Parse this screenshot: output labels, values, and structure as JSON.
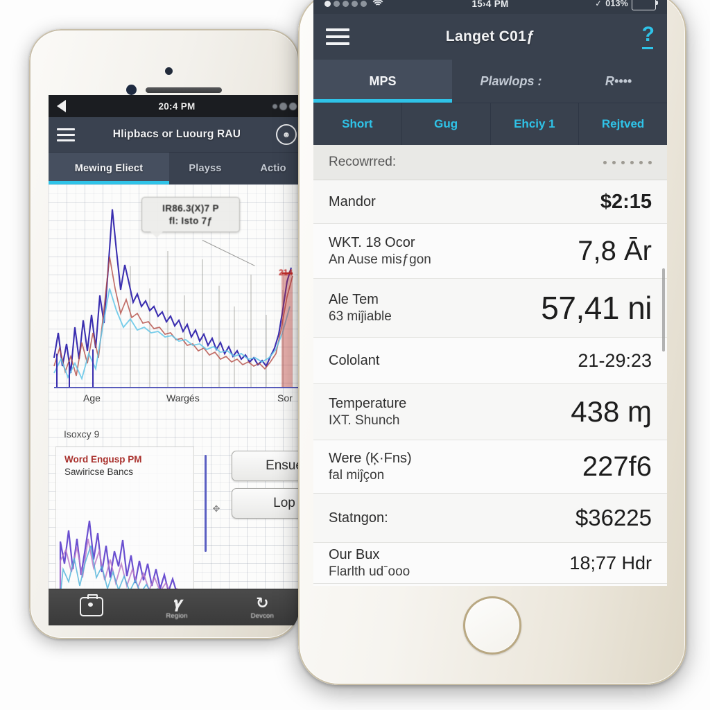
{
  "left_phone": {
    "status_bar": {
      "time": "20:4 PM",
      "back_icon": "back-arrow-icon"
    },
    "navbar": {
      "menu_icon": "hamburger-menu-icon",
      "title": "Hlipbacs or Luourg RAU",
      "avatar_icon": "user-avatar-icon"
    },
    "tabs": [
      {
        "label": "Mewing Eliect",
        "active": true
      },
      {
        "label": "Playss",
        "active": false
      },
      {
        "label": "Actio",
        "active": false
      }
    ],
    "chart": {
      "tooltip": {
        "line1": "IR86.3(X)7 P",
        "line2": "fl: Isto 7ƒ"
      },
      "red_annotation": "214",
      "x_labels": [
        "Age",
        "Wargés",
        "Sor"
      ],
      "section_label": "Isoxcy 9"
    },
    "mini_chart": {
      "legend": [
        {
          "label": "Word Engusp PM",
          "color": "#a9302c"
        },
        {
          "label": "Sawiricse Bancs",
          "color": "#333333"
        }
      ]
    },
    "buttons": [
      {
        "label": "Ensue"
      },
      {
        "label": "Lop"
      }
    ],
    "tab_bar": [
      {
        "icon": "camera-icon",
        "label": ""
      },
      {
        "icon": "pen-icon",
        "label": "Region"
      },
      {
        "icon": "refresh-icon",
        "label": "Devcon"
      }
    ]
  },
  "right_phone": {
    "status_bar": {
      "carrier": "● ● ● ● ●",
      "wifi_icon": "wifi-icon",
      "time": "15›4 PM",
      "check_icon": "check-icon",
      "battery_pct": "013%",
      "battery_icon": "battery-icon"
    },
    "navbar": {
      "menu_icon": "hamburger-menu-icon",
      "title": "Langet C01ƒ",
      "help_label": "?"
    },
    "tabs": [
      {
        "label": "MPS",
        "active": true
      },
      {
        "label": "Plawlops :",
        "active": false
      },
      {
        "label": "R••••",
        "active": false
      }
    ],
    "sub_tabs": [
      {
        "label": "Short"
      },
      {
        "label": "Gug"
      },
      {
        "label": "Ehciy 1"
      },
      {
        "label": "Rejtved"
      }
    ],
    "list_header": {
      "label": "Recowrred:",
      "trailing_dots": 6
    },
    "rows": [
      {
        "primary": "Mandor",
        "secondary": "",
        "value": "$2:15"
      },
      {
        "primary": "WKT. 18 Ocor",
        "secondary": "An Ause misƒgon",
        "value": "7,8 Ār"
      },
      {
        "primary": "Ale Tem",
        "secondary": "63 miĵiable",
        "value": "57,41 ni"
      },
      {
        "primary": "Cololant",
        "secondary": "",
        "value": "21-29:23"
      },
      {
        "primary": "Temperature",
        "secondary": "IXT. Shunch",
        "value": "438 ɱ"
      },
      {
        "primary": "Were (Ķ·Fns)",
        "secondary": "fal miĵçon",
        "value": "227f6"
      },
      {
        "primary": "Statngon:",
        "secondary": "",
        "value": "$36225"
      },
      {
        "primary": "Our Bux",
        "secondary": "Flarlth udˉooo",
        "value": "18;77 Hdr"
      }
    ]
  },
  "colors": {
    "accent_cyan": "#2fc3e8",
    "navbar_dark": "#39414e",
    "tab_active_bg": "#444d5c",
    "list_bg": "#fbfbfb",
    "legend_red": "#a9302c"
  }
}
